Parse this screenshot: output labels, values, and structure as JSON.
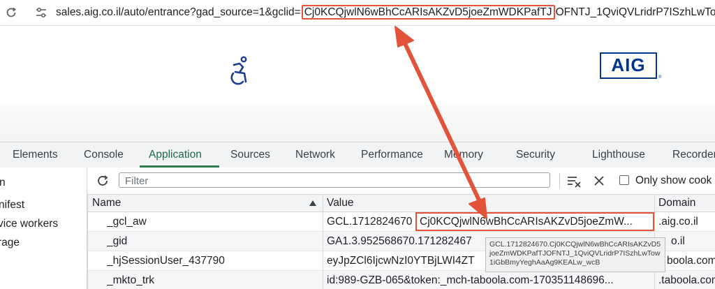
{
  "browser": {
    "url_prefix": "sales.aig.co.il/auto/entrance?gad_source=1&gclid=",
    "url_highlight": "Cj0KCQjwlN6wBhCcARIsAKZvD5joeZmWDKPafTJ",
    "url_suffix": "OFNTJ_1QviQVLridrP7ISzhLwTo..."
  },
  "page": {
    "logo_text": "AIG",
    "logo_dot": "®"
  },
  "devtools": {
    "tabs": [
      {
        "label": "Elements"
      },
      {
        "label": "Console"
      },
      {
        "label": "Application",
        "active": true
      },
      {
        "label": "Sources"
      },
      {
        "label": "Network"
      },
      {
        "label": "Performance"
      },
      {
        "label": "Memory"
      },
      {
        "label": "Security"
      },
      {
        "label": "Lighthouse"
      },
      {
        "label": "Recorder"
      }
    ],
    "sidebar": [
      "n",
      "nifest",
      "vice workers",
      "rage"
    ],
    "toolbar": {
      "filter_placeholder": "Filter",
      "only_show_label": "Only show cook"
    },
    "columns": [
      "Name",
      "Value",
      "Domain"
    ],
    "rows": [
      {
        "name": "_gcl_aw",
        "value_prefix": "GCL.1712824670",
        "value_highlight": "Cj0KCQjwlN6wBhCcARIsAKZvD5joeZmW...",
        "domain": ".aig.co.il"
      },
      {
        "name": "_gid",
        "value": "GA1.3.952568670.171282467",
        "domain": "o.il"
      },
      {
        "name": "_hjSessionUser_437790",
        "value": "eyJpZCl6IjcwNzI0YTBjLWI4ZT",
        "domain": "boola.com"
      },
      {
        "name": "_mkto_trk",
        "value": "id:989-GZB-065&token:_mch-taboola.com-170351148696...",
        "domain": ".taboola.com"
      }
    ],
    "tooltip": "GCL.1712824670.Cj0KCQjwlN6wBhCcARIsAKZvD5joeZmWDKPafTJOFNTJ_1QviQVLridrP7ISzhLwTow1iGbBmyYeghAaAg9KEALw_wcB"
  },
  "colors": {
    "highlight_red": "#e2533a",
    "active_tab_green": "#1a6b47",
    "aig_blue": "#00358e"
  }
}
